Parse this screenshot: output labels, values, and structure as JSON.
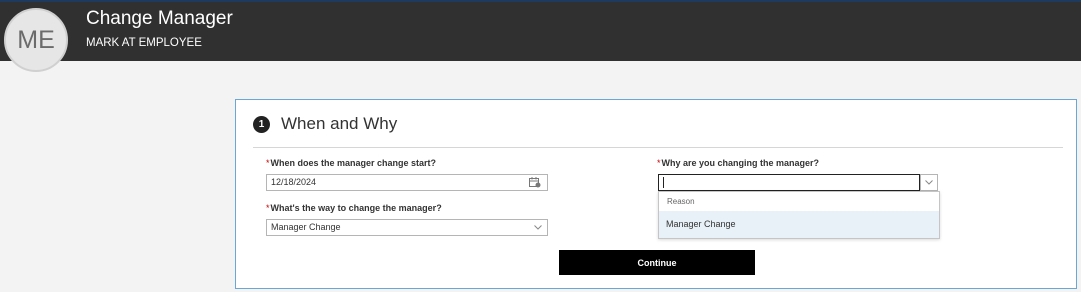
{
  "header": {
    "avatar_initials": "ME",
    "title": "Change Manager",
    "subtitle": "MARK AT EMPLOYEE"
  },
  "section": {
    "step_number": "1",
    "title": "When and Why"
  },
  "form": {
    "required_marker": "*",
    "start_date": {
      "label": "When does the manager change start?",
      "value": "12/18/2024"
    },
    "change_way": {
      "label": "What's the way to change the manager?",
      "value": "Manager Change"
    },
    "reason": {
      "label": "Why are you changing the manager?",
      "value": "",
      "dropdown_header": "Reason",
      "options": [
        "Manager Change"
      ]
    }
  },
  "actions": {
    "continue_label": "Continue"
  },
  "colors": {
    "header_bg": "#303030",
    "card_border": "#6aa6d6",
    "button_bg": "#000000",
    "option_highlight": "#e8f1f7"
  },
  "icons": [
    "calendar-icon",
    "chevron-down-icon"
  ]
}
